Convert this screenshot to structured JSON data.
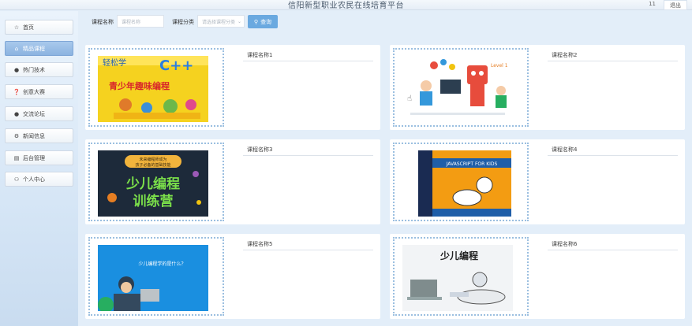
{
  "header": {
    "title": "信阳新型职业农民在线培育平台",
    "user": "11",
    "logout": "退出"
  },
  "sidebar": {
    "items": [
      {
        "label": "首页",
        "icon": "star-icon"
      },
      {
        "label": "精品课程",
        "icon": "home-icon"
      },
      {
        "label": "热门技术",
        "icon": "circle-icon"
      },
      {
        "label": "创意大赛",
        "icon": "question-icon"
      },
      {
        "label": "交流论坛",
        "icon": "info-icon"
      },
      {
        "label": "新闻信息",
        "icon": "gear-icon"
      },
      {
        "label": "后台管理",
        "icon": "box-icon"
      },
      {
        "label": "个人中心",
        "icon": "person-icon"
      }
    ]
  },
  "search": {
    "name_label": "课程名称",
    "name_placeholder": "课程名称",
    "category_label": "课程分类",
    "category_placeholder": "请选择课程分类",
    "button": "查询"
  },
  "courses": [
    {
      "name": "课程名称1",
      "cover_text": [
        "轻松学",
        "C++",
        "青少年趣味编程"
      ]
    },
    {
      "name": "课程名称2",
      "cover_text": [
        "Level 1"
      ]
    },
    {
      "name": "课程名称3",
      "cover_text": [
        "未来编程师成为",
        "孩子必备的基础技能",
        "少儿编程",
        "训练营"
      ]
    },
    {
      "name": "课程名称4",
      "cover_text": [
        "JAVASCRIPT FOR KIDS"
      ]
    },
    {
      "name": "课程名称5",
      "cover_text": [
        "少儿编程学的是什么?"
      ]
    },
    {
      "name": "课程名称6",
      "cover_text": [
        "少儿编程"
      ]
    }
  ],
  "colors": {
    "accent": "#6aa9e0",
    "active_nav": "#8bb3e0",
    "frame": "#9bbfe0"
  }
}
